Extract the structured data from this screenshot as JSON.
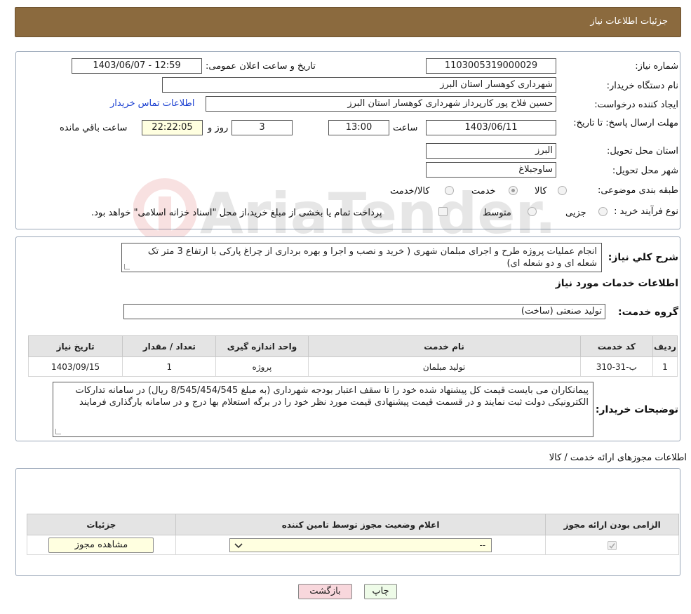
{
  "header": {
    "title": "جزئیات اطلاعات نیاز"
  },
  "need_info": {
    "need_number_label": "شماره نیاز:",
    "need_number": "1103005319000029",
    "announce_label": "تاریخ و ساعت اعلان عمومی:",
    "announce_value": "1403/06/07 - 12:59",
    "buyer_org_label": "نام دستگاه خریدار:",
    "buyer_org": "شهرداری کوهسار استان البرز",
    "creator_label": "ایجاد کننده درخواست:",
    "creator": "حسین فلاح پور کارپرداز شهرداری کوهسار استان البرز",
    "contact_link": "اطلاعات تماس خریدار",
    "deadline_label": "مهلت ارسال پاسخ: تا تاریخ:",
    "deadline_date": "1403/06/11",
    "time_label": "ساعت",
    "deadline_time": "13:00",
    "days_value": "3",
    "days_label": "روز و",
    "remaining_time": "22:22:05",
    "remaining_label": "ساعت باقي مانده",
    "province_label": "استان محل تحویل:",
    "province": "البرز",
    "city_label": "شهر محل تحویل:",
    "city": "ساوجبلاغ",
    "category_label": "طبقه بندی موضوعی:",
    "category_options": [
      "کالا",
      "خدمت",
      "کالا/خدمت"
    ],
    "category_selected": "خدمت",
    "process_label": "نوع فرآیند خرید :",
    "process_options": [
      "جزیی",
      "متوسط"
    ],
    "process_note": "پرداخت تمام یا بخشی از مبلغ خرید،از محل \"اسناد خزانه اسلامی\" خواهد بود."
  },
  "description": {
    "label": "شرح کلي نياز:",
    "text": "انجام عملیات پروژه  طرح و اجرای مبلمان شهری ( خرید و نصب و اجرا و بهره برداری از چراغ پارکی با ارتفاع 3 متر تک     شعله ای و دو شعله ای)"
  },
  "services": {
    "section_title": "اطلاعات خدمات مورد نیاز",
    "group_label": "گروه خدمت:",
    "group_value": "تولید صنعتی (ساخت)",
    "columns": [
      "ردیف",
      "کد خدمت",
      "نام خدمت",
      "واحد اندازه گیری",
      "تعداد / مقدار",
      "تاریخ نیاز"
    ],
    "rows": [
      [
        "1",
        "ب-31-310",
        "تولید مبلمان",
        "پروژه",
        "1",
        "1403/09/15"
      ]
    ]
  },
  "buyer_notes": {
    "label": "توضیحات خریدار:",
    "text": "پیمانکاران می بایست قیمت کل پیشنهاد شده خود را تا سقف اعتبار بودجه شهرداری (به مبلغ 8/545/454/545 ریال) در سامانه تدارکات الکترونیکی دولت ثبت نمایند و در قسمت قیمت پیشنهادی قیمت مورد نظر خود را در برگه استعلام بها درج و در سامانه بارگذاری  فرمایند"
  },
  "permits": {
    "section_title": "اطلاعات مجوزهای ارائه خدمت / کالا",
    "columns": [
      "الزامی بودن ارائه مجوز",
      "اعلام وضعیت مجوز توسط تامین کننده",
      "جزئیات"
    ],
    "select_value": "--",
    "view_button": "مشاهده مجوز"
  },
  "footer": {
    "print_label": "چاپ",
    "back_label": "بازگشت"
  },
  "watermark": {
    "text": "AriaTender.neT"
  },
  "colors": {
    "header_bg": "#8b6a3e",
    "back_button_bg": "#f8d7dc",
    "print_button_bg": "#eefbe8",
    "link": "#1a3fd1"
  }
}
